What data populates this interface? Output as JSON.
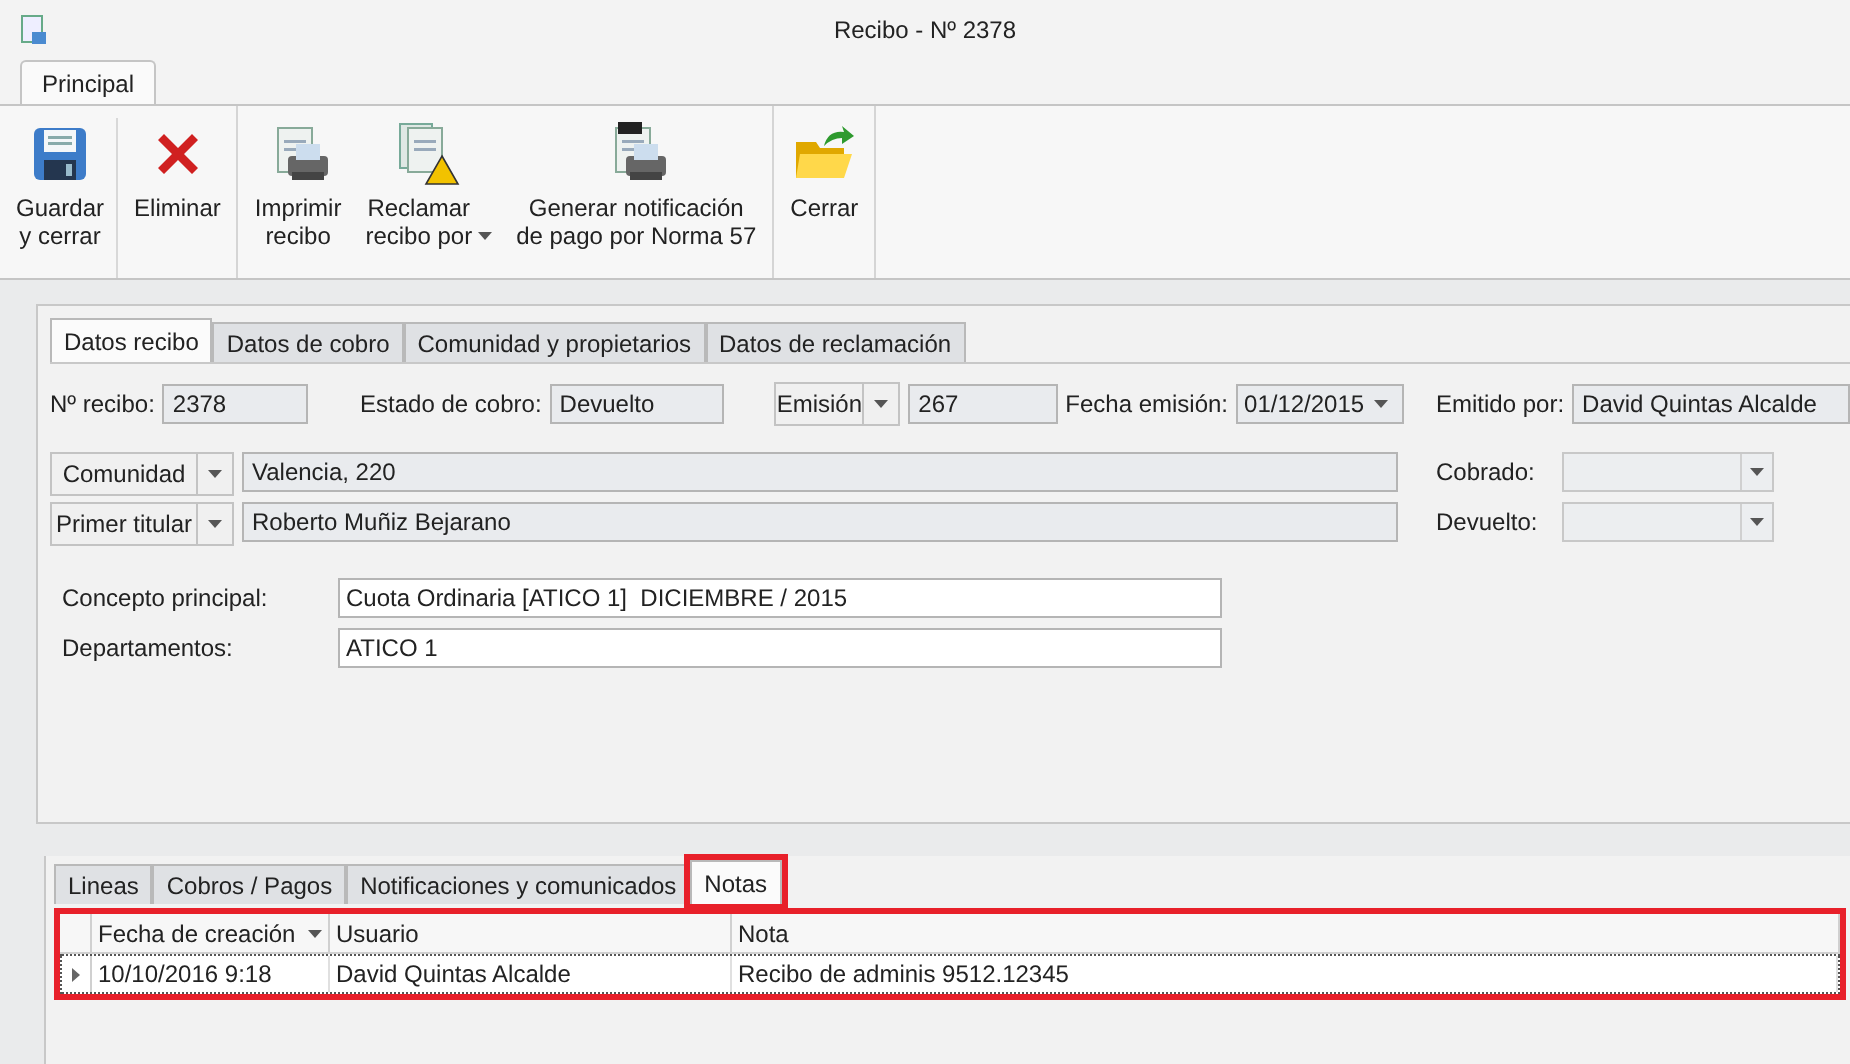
{
  "window": {
    "title": "Recibo - Nº 2378"
  },
  "ribbon_tabs": [
    {
      "label": "Principal",
      "selected": true
    }
  ],
  "ribbon_groups": [
    {
      "buttons": [
        {
          "kind": "save",
          "label": "Guardar\ny cerrar",
          "dropdown": false
        },
        {
          "kind": "delete",
          "label": "Eliminar",
          "dropdown": false
        }
      ]
    },
    {
      "buttons": [
        {
          "kind": "print",
          "label": "Imprimir\nrecibo",
          "dropdown": false
        },
        {
          "kind": "claim",
          "label": "Reclamar\nrecibo por",
          "dropdown": true
        },
        {
          "kind": "norma",
          "label": "Generar notificación\nde pago por Norma 57",
          "dropdown": false
        }
      ]
    },
    {
      "buttons": [
        {
          "kind": "close",
          "label": "Cerrar",
          "dropdown": false
        }
      ]
    }
  ],
  "form_tabs": [
    {
      "label": "Datos recibo",
      "selected": true
    },
    {
      "label": "Datos de cobro",
      "selected": false
    },
    {
      "label": "Comunidad y propietarios",
      "selected": false
    },
    {
      "label": "Datos de reclamación",
      "selected": false
    }
  ],
  "header_fields": {
    "receipt_label": "Nº recibo:",
    "receipt": "2378",
    "status_label": "Estado de cobro:",
    "status": "Devuelto",
    "series_button": "Emisión",
    "series": "267",
    "date_label": "Fecha emisión:",
    "date": "01/12/2015",
    "issuer_label": "Emitido por:",
    "issuer": "David Quintas Alcalde"
  },
  "community": {
    "button": "Comunidad",
    "value": "Valencia, 220"
  },
  "owner": {
    "button": "Primer titular",
    "value": "Roberto Muñiz Bejarano"
  },
  "paid_label": "Cobrado:",
  "returned_label": "Devuelto:",
  "concept": {
    "label": "Concepto principal:",
    "value": "Cuota Ordinaria [ATICO 1]  DICIEMBRE / 2015"
  },
  "departments": {
    "label": "Departamentos:",
    "value": "ATICO 1"
  },
  "bottom_tabs": [
    {
      "label": "Lineas",
      "selected": false,
      "highlighted": false
    },
    {
      "label": "Cobros / Pagos",
      "selected": false,
      "highlighted": false
    },
    {
      "label": "Notificaciones y comunicados",
      "selected": false,
      "highlighted": false
    },
    {
      "label": "Notas",
      "selected": true,
      "highlighted": true
    }
  ],
  "notes_table": {
    "highlighted": true,
    "columns": [
      {
        "label": "Fecha de creación",
        "sorted": true
      },
      {
        "label": "Usuario",
        "sorted": false
      },
      {
        "label": "Nota",
        "sorted": false
      }
    ],
    "rows": [
      {
        "cells": [
          "10/10/2016 9:18",
          "David Quintas Alcalde",
          "Recibo de adminis 9512.12345"
        ],
        "selected": true
      }
    ]
  }
}
